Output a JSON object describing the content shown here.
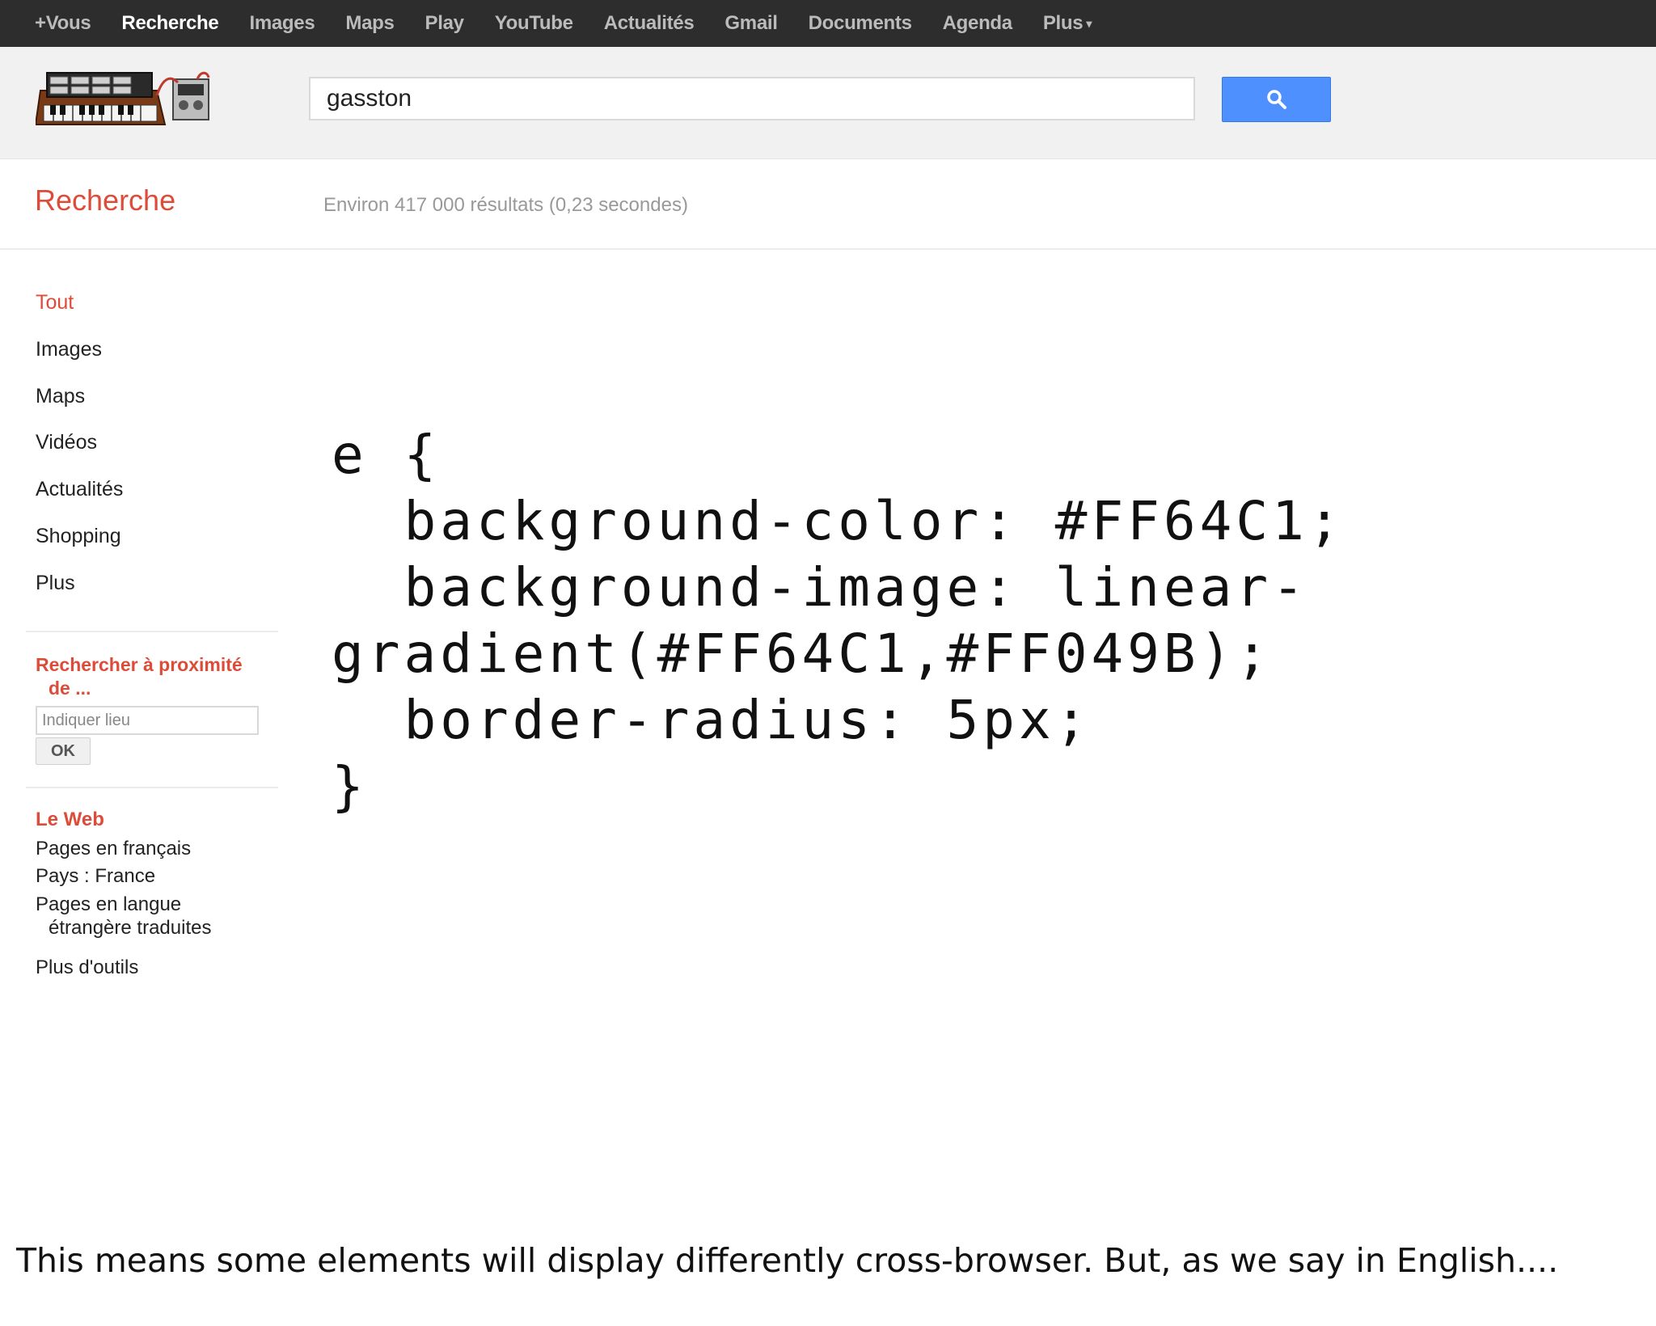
{
  "topbar": {
    "items": [
      {
        "label": "+Vous"
      },
      {
        "label": "Recherche",
        "active": true
      },
      {
        "label": "Images"
      },
      {
        "label": "Maps"
      },
      {
        "label": "Play"
      },
      {
        "label": "YouTube"
      },
      {
        "label": "Actualités"
      },
      {
        "label": "Gmail"
      },
      {
        "label": "Documents"
      },
      {
        "label": "Agenda"
      },
      {
        "label": "Plus"
      }
    ]
  },
  "search": {
    "value": "gasston",
    "button_icon": "search-icon"
  },
  "results": {
    "section_title": "Recherche",
    "stats": "Environ 417 000 résultats (0,23 secondes)"
  },
  "sidebar": {
    "nav": [
      {
        "label": "Tout",
        "selected": true
      },
      {
        "label": "Images"
      },
      {
        "label": "Maps"
      },
      {
        "label": "Vidéos"
      },
      {
        "label": "Actualités"
      },
      {
        "label": "Shopping"
      },
      {
        "label": "Plus"
      }
    ],
    "nearby": {
      "title_line1": "Rechercher à proximité",
      "title_line2": "de ...",
      "placeholder": "Indiquer lieu",
      "ok_label": "OK"
    },
    "web": {
      "title": "Le Web",
      "pages_fr": "Pages en français",
      "country": "Pays : France",
      "translated_line1": "Pages en langue",
      "translated_line2": "étrangère traduites",
      "more_tools": "Plus d'outils"
    }
  },
  "code_snippet": "e {\n  background-color: #FF64C1;\n  background-image: linear-\ngradient(#FF64C1,#FF049B);\n  border-radius: 5px;\n}",
  "caption": "This means some elements will display differently cross-browser. But, as we say in English....",
  "colors": {
    "accent_red": "#dd4b39",
    "button_blue": "#4d90fe",
    "topbar_bg": "#2d2d2d"
  }
}
